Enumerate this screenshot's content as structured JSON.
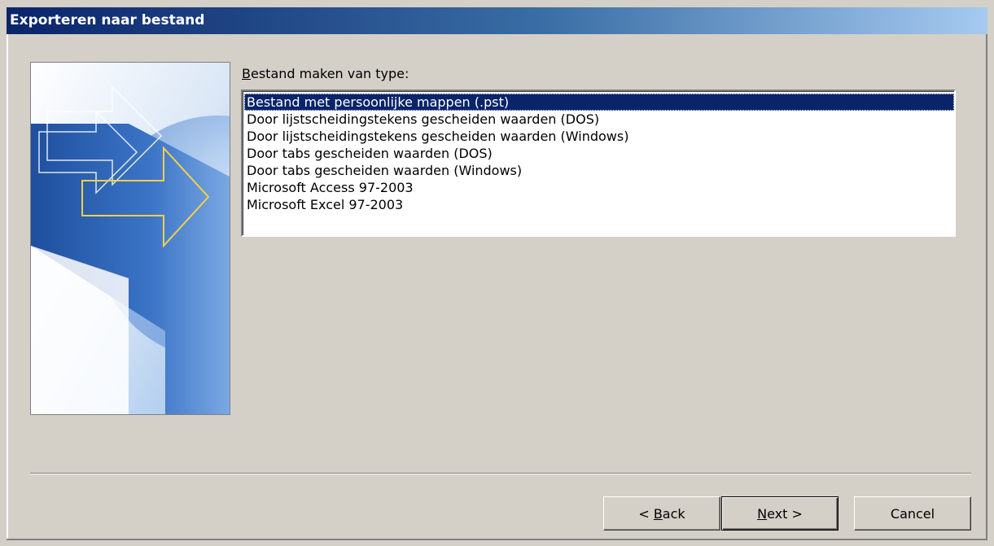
{
  "window": {
    "title": "Exporteren naar bestand"
  },
  "prompt": {
    "mnemonic": "B",
    "rest": "estand maken van type:"
  },
  "file_types": [
    {
      "label": "Bestand met persoonlijke mappen (.pst)",
      "selected": true
    },
    {
      "label": "Door lijstscheidingstekens gescheiden waarden (DOS)",
      "selected": false
    },
    {
      "label": "Door lijstscheidingstekens gescheiden waarden (Windows)",
      "selected": false
    },
    {
      "label": "Door tabs gescheiden waarden (DOS)",
      "selected": false
    },
    {
      "label": "Door tabs gescheiden waarden (Windows)",
      "selected": false
    },
    {
      "label": "Microsoft Access 97-2003",
      "selected": false
    },
    {
      "label": "Microsoft Excel 97-2003",
      "selected": false
    }
  ],
  "buttons": {
    "back": {
      "pre": "< ",
      "mnemonic": "B",
      "post": "ack"
    },
    "next": {
      "pre": "",
      "mnemonic": "N",
      "post": "ext >"
    },
    "cancel": "Cancel"
  },
  "colors": {
    "selection": "#0a246a",
    "dialog_background": "#d4d0c8",
    "title_gradient_start": "#0a246a",
    "title_gradient_end": "#a6caf0"
  }
}
